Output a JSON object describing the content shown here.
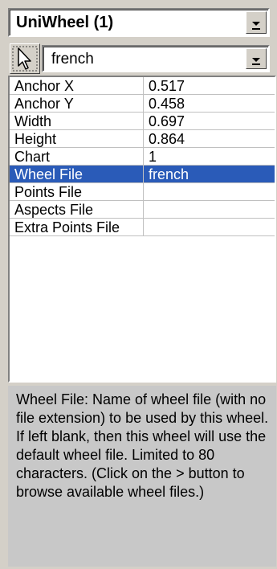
{
  "object_selector": {
    "value": "UniWheel (1)"
  },
  "wheel_selector": {
    "value": "french"
  },
  "properties": [
    {
      "name": "Anchor X",
      "value": "0.517",
      "selected": false
    },
    {
      "name": "Anchor Y",
      "value": "0.458",
      "selected": false
    },
    {
      "name": "Width",
      "value": "0.697",
      "selected": false
    },
    {
      "name": "Height",
      "value": "0.864",
      "selected": false
    },
    {
      "name": "Chart",
      "value": "1",
      "selected": false
    },
    {
      "name": "Wheel File",
      "value": "french",
      "selected": true
    },
    {
      "name": "Points File",
      "value": "",
      "selected": false
    },
    {
      "name": "Aspects File",
      "value": "",
      "selected": false
    },
    {
      "name": "Extra Points File",
      "value": "",
      "selected": false
    }
  ],
  "help": {
    "text": "Wheel File: Name of wheel file (with no file extension) to be used by this wheel. If left blank, then this wheel will use the default wheel file. Limited to 80 characters. (Click on the > button to browse available wheel files.)"
  },
  "icons": {
    "pointer": "cursor-arrow-icon",
    "dropdown": "chevron-down-icon"
  },
  "colors": {
    "selection": "#2a5bb8",
    "panel": "#d4d0c8",
    "help_bg": "#c8c8c8"
  }
}
